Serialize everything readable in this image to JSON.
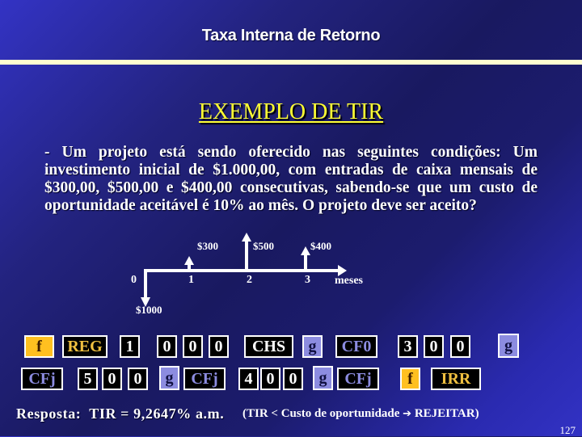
{
  "slide": {
    "title": "Taxa Interna de Retorno",
    "subtitle": "EXEMPLO DE TIR",
    "problem_text": "- Um projeto está sendo oferecido nas seguintes condições: Um investimento inicial de $1.000,00, com entradas de caixa mensais de $300,00, $500,00 e $400,00 consecutivas, sabendo-se que um custo de oportunidade aceitável é 10% ao mês. O projeto deve ser aceito?",
    "page_number": "127"
  },
  "cash_flow": {
    "unit_label": "meses",
    "periods": [
      {
        "period": "0",
        "amount_label": "$1000",
        "direction": "out",
        "value": -1000
      },
      {
        "period": "1",
        "amount_label": "$300",
        "direction": "in",
        "value": 300
      },
      {
        "period": "2",
        "amount_label": "$500",
        "direction": "in",
        "value": 500
      },
      {
        "period": "3",
        "amount_label": "$400",
        "direction": "in",
        "value": 400
      }
    ]
  },
  "calculator": {
    "row1": [
      {
        "label": "f",
        "style": "f"
      },
      {
        "label": "REG",
        "style": "gold"
      },
      {
        "label": "1",
        "style": "num"
      },
      {
        "label": "0",
        "style": "num"
      },
      {
        "label": "0",
        "style": "num"
      },
      {
        "label": "0",
        "style": "num"
      },
      {
        "label": "CHS",
        "style": "num"
      },
      {
        "label": "g",
        "style": "g"
      },
      {
        "label": "CF0",
        "style": "blue"
      },
      {
        "label": "3",
        "style": "num"
      },
      {
        "label": "0",
        "style": "num"
      },
      {
        "label": "0",
        "style": "num"
      },
      {
        "label": "g",
        "style": "g"
      }
    ],
    "row2": [
      {
        "label": "CFj",
        "style": "blue"
      },
      {
        "label": "5",
        "style": "num"
      },
      {
        "label": "0",
        "style": "num"
      },
      {
        "label": "0",
        "style": "num"
      },
      {
        "label": "g",
        "style": "g"
      },
      {
        "label": "CFj",
        "style": "blue"
      },
      {
        "label": "4",
        "style": "num"
      },
      {
        "label": "0",
        "style": "num"
      },
      {
        "label": "0",
        "style": "num"
      },
      {
        "label": "g",
        "style": "g"
      },
      {
        "label": "CFj",
        "style": "blue"
      },
      {
        "label": "f",
        "style": "f"
      },
      {
        "label": "IRR",
        "style": "gold"
      }
    ]
  },
  "answer": {
    "text": "Resposta:  TIR = 9,2647% a.m.",
    "irr_percent": 9.2647,
    "note_prefix": "(TIR < Custo de oportunidade ",
    "arrow_glyph": "➔",
    "note_suffix": " REJEITAR)"
  },
  "colors": {
    "title_rule": "#fffdd0",
    "subtitle": "#ffff33",
    "key_f": "#ffc020",
    "key_g": "#8c8ce0",
    "key_gold_text": "#f0c040",
    "key_blue_text": "#8c8ce0"
  }
}
